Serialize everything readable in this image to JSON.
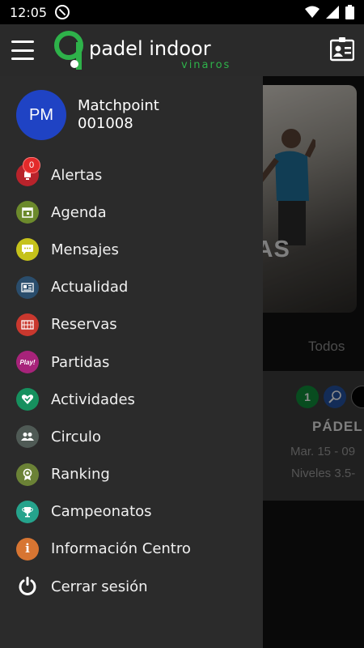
{
  "status_bar": {
    "time": "12:05"
  },
  "app": {
    "brand_main": "padel indoor",
    "brand_sub": "vinaros"
  },
  "profile": {
    "initials": "PM",
    "name": "Matchpoint",
    "id": "001008"
  },
  "alerts": {
    "count": "0"
  },
  "menu": [
    {
      "label": "Alertas",
      "icon": "alarm-icon",
      "color": "#b8232b"
    },
    {
      "label": "Agenda",
      "icon": "calendar-icon",
      "color": "#6c8a2c"
    },
    {
      "label": "Mensajes",
      "icon": "chat-icon",
      "color": "#c5c21b"
    },
    {
      "label": "Actualidad",
      "icon": "newspaper-icon",
      "color": "#2a4d6c"
    },
    {
      "label": "Reservas",
      "icon": "court-icon",
      "color": "#c9382e"
    },
    {
      "label": "Partidas",
      "icon": "play-icon",
      "color": "#a7237a",
      "icon_text": "Play!"
    },
    {
      "label": "Actividades",
      "icon": "heart-icon",
      "color": "#16905e"
    },
    {
      "label": "Circulo",
      "icon": "group-icon",
      "color": "#4f5a55"
    },
    {
      "label": "Ranking",
      "icon": "medal-icon",
      "color": "#6b8236"
    },
    {
      "label": "Campeonatos",
      "icon": "trophy-icon",
      "color": "#25a38c"
    },
    {
      "label": "Información Centro",
      "icon": "info-icon",
      "color": "#d77532",
      "icon_text": "i"
    },
    {
      "label": "Cerrar sesión",
      "icon": "power-icon",
      "color": "#2b2b2b"
    }
  ],
  "background": {
    "hero_text": "TAS",
    "filter_tab": "Todos",
    "match_badge": "1",
    "match_sport": "PÁDEL",
    "match_date": "Mar. 15 - 09",
    "match_level": "Niveles 3.5-"
  }
}
